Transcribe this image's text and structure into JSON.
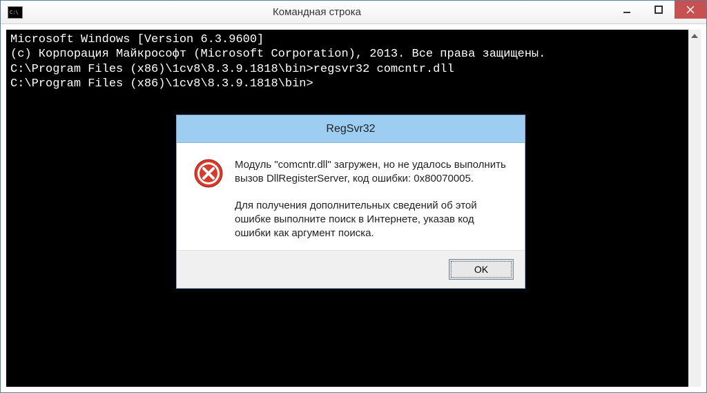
{
  "window": {
    "title": "Командная строка",
    "icon_label": "C:\\"
  },
  "console": {
    "lines": [
      "Microsoft Windows [Version 6.3.9600]",
      "(c) Корпорация Майкрософт (Microsoft Corporation), 2013. Все права защищены.",
      "",
      "C:\\Program Files (x86)\\1cv8\\8.3.9.1818\\bin>regsvr32 comcntr.dll",
      "",
      "C:\\Program Files (x86)\\1cv8\\8.3.9.1818\\bin>"
    ]
  },
  "dialog": {
    "title": "RegSvr32",
    "message1": "Модуль \"comcntr.dll\" загружен, но не удалось выполнить вызов DllRegisterServer, код ошибки: 0x80070005.",
    "message2": "Для получения дополнительных сведений об этой ошибке выполните поиск в Интернете, указав код ошибки как аргумент поиска.",
    "ok_label": "OK"
  }
}
